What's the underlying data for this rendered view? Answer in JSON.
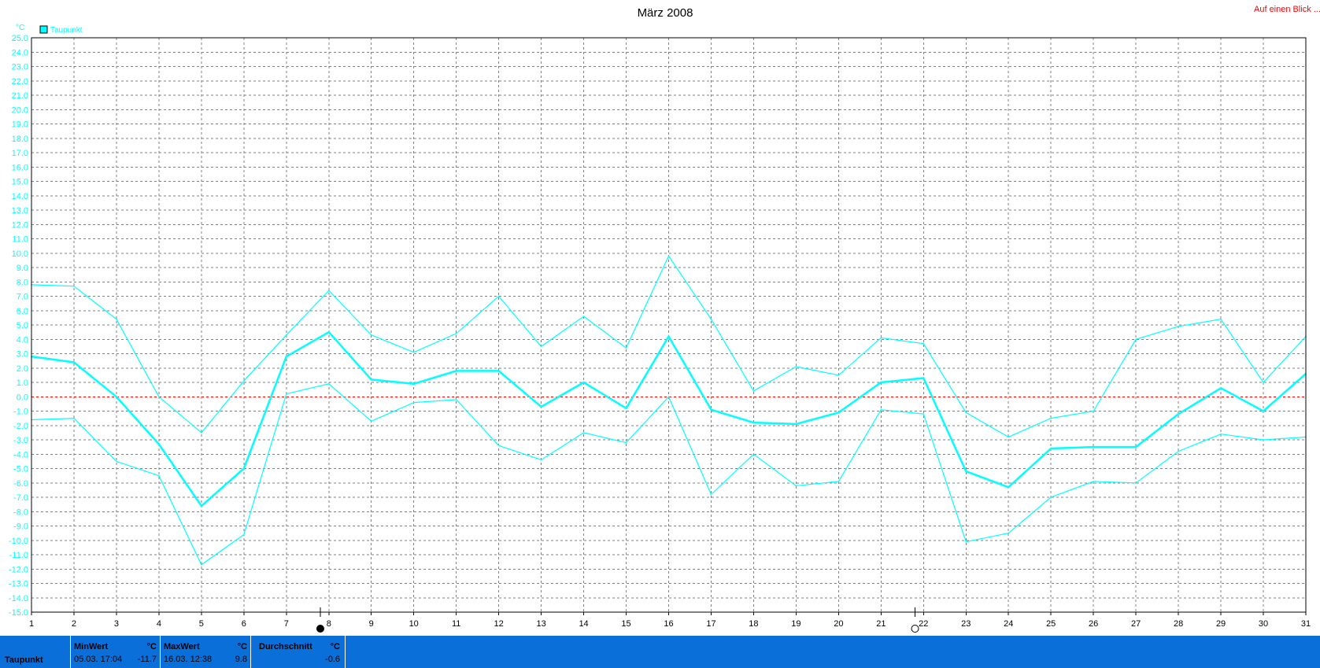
{
  "chart_data": {
    "type": "line",
    "title": "März 2008",
    "unit": "°C",
    "ylim": [
      -15,
      25
    ],
    "y_step": 1,
    "x": [
      1,
      2,
      3,
      4,
      5,
      6,
      7,
      8,
      9,
      10,
      11,
      12,
      13,
      14,
      15,
      16,
      17,
      18,
      19,
      20,
      21,
      22,
      23,
      24,
      25,
      26,
      27,
      28,
      29,
      30,
      31
    ],
    "legend": [
      "Taupunkt"
    ],
    "series": [
      {
        "name": "Taupunkt",
        "role": "avg",
        "values": [
          2.8,
          2.4,
          0.0,
          -3.3,
          -7.6,
          -5.0,
          2.8,
          4.5,
          1.2,
          0.9,
          1.8,
          1.8,
          -0.7,
          1.0,
          -0.8,
          4.2,
          -0.9,
          -1.8,
          -1.9,
          -1.1,
          1.0,
          1.3,
          -5.2,
          -6.3,
          -3.6,
          -3.5,
          -3.5,
          -1.2,
          0.6,
          -1.0,
          1.6
        ]
      },
      {
        "role": "max",
        "values": [
          7.8,
          7.7,
          5.4,
          0.0,
          -2.5,
          1.1,
          4.3,
          7.4,
          4.3,
          3.1,
          4.4,
          7.0,
          3.5,
          5.6,
          3.4,
          9.8,
          5.4,
          0.4,
          2.1,
          1.5,
          4.1,
          3.7,
          -1.1,
          -2.8,
          -1.5,
          -1.0,
          4.0,
          4.9,
          5.4,
          1.0,
          4.2
        ]
      },
      {
        "role": "min",
        "values": [
          -1.6,
          -1.5,
          -4.5,
          -5.5,
          -11.7,
          -9.6,
          0.2,
          0.9,
          -1.7,
          -0.4,
          -0.2,
          -3.4,
          -4.4,
          -2.5,
          -3.2,
          0.0,
          -6.8,
          -4.0,
          -6.2,
          -5.9,
          -0.9,
          -1.2,
          -10.1,
          -9.5,
          -7.0,
          -5.9,
          -6.0,
          -3.8,
          -2.6,
          -3.0,
          -2.8
        ]
      }
    ],
    "zero_line": 0,
    "marker_days": [
      7.8,
      21.8
    ],
    "colors": {
      "series": "#00ffff",
      "grid": "#808080",
      "zero": "#ff0000",
      "axis": "#000000",
      "tick_text": "#00ffff"
    }
  },
  "corner_link": "Auf einen Blick ...",
  "footer": {
    "series_label": "Taupunkt",
    "min": {
      "label": "MinWert",
      "unit": "°C",
      "date_time": "05.03.  17:04",
      "value": "-11.7"
    },
    "max": {
      "label": "MaxWert",
      "unit": "°C",
      "date_time": "16.03.  12:38",
      "value": "9.8"
    },
    "avg": {
      "label": "Durchschnitt",
      "unit": "°C",
      "value": "-0.6"
    },
    "color": "#0a6fd8"
  }
}
